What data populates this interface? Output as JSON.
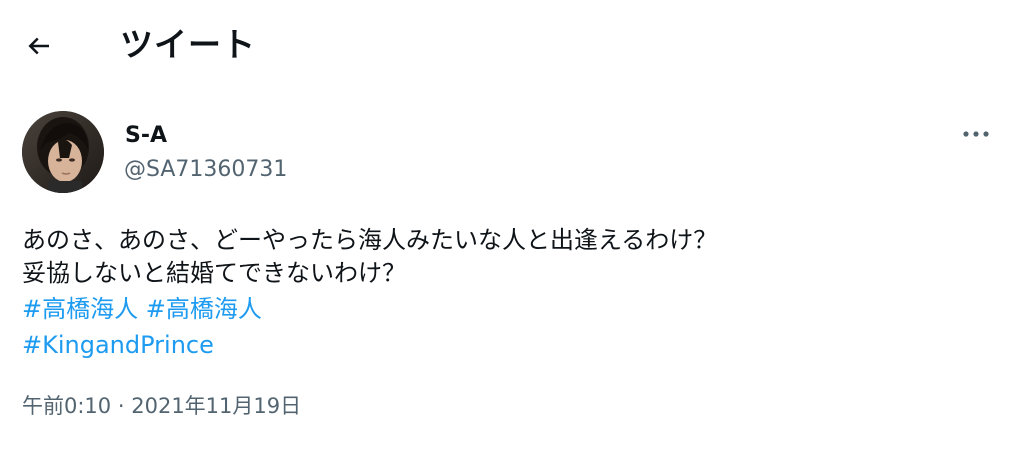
{
  "header": {
    "back_icon": "arrow-left-icon",
    "title": "ツイート"
  },
  "author": {
    "display_name": "S-A",
    "handle": "@SA71360731",
    "avatar_icon": "user-avatar"
  },
  "more_icon": "more-horizontal-icon",
  "tweet": {
    "lines": [
      "あのさ、あのさ、どーやったら海人みたいな人と出逢えるわけ？",
      "妥協しないと結婚てできないわけ？"
    ],
    "hashtags_line1": [
      "#高橋海人",
      "#高橋海人"
    ],
    "hashtags_line2": [
      "#KingandPrince"
    ],
    "time": "午前0:10",
    "separator": "·",
    "date": "2021年11月19日"
  },
  "colors": {
    "text": "#0f1419",
    "secondary": "#536471",
    "link": "#1d9bf0"
  }
}
